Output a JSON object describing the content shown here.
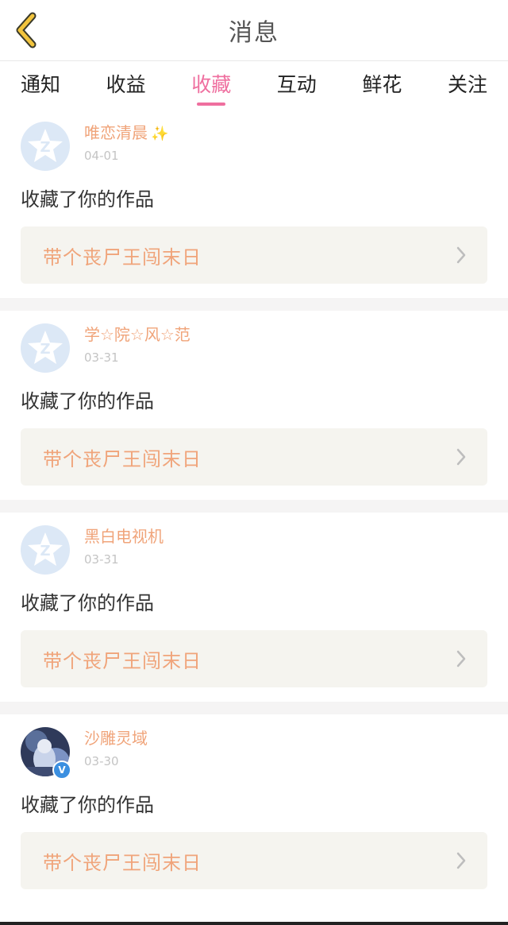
{
  "header": {
    "title": "消息",
    "back_icon": "chevron-left-icon",
    "accent": "#f2c43d"
  },
  "tabs": [
    {
      "label": "通知",
      "active": false
    },
    {
      "label": "收益",
      "active": false
    },
    {
      "label": "收藏",
      "active": true
    },
    {
      "label": "互动",
      "active": false
    },
    {
      "label": "鲜花",
      "active": false
    },
    {
      "label": "关注",
      "active": false
    }
  ],
  "colors": {
    "active_tab": "#ef6f9f",
    "username": "#f0a47a",
    "work_card_bg": "#f5f4ef"
  },
  "messages": [
    {
      "username": "唯恋清晨",
      "has_sparkle": true,
      "date": "04-01",
      "action": "收藏了你的作品",
      "work_title": "带个丧尸王闯末日",
      "avatar": "default-star-avatar"
    },
    {
      "username": "学☆院☆风☆范",
      "has_sparkle": false,
      "date": "03-31",
      "action": "收藏了你的作品",
      "work_title": "带个丧尸王闯末日",
      "avatar": "default-star-avatar"
    },
    {
      "username": "黑白电视机",
      "has_sparkle": false,
      "date": "03-31",
      "action": "收藏了你的作品",
      "work_title": "带个丧尸王闯末日",
      "avatar": "default-star-avatar"
    },
    {
      "username": "沙雕灵域",
      "has_sparkle": false,
      "date": "03-30",
      "action": "收藏了你的作品",
      "work_title": "带个丧尸王闯末日",
      "avatar": "photo-avatar",
      "verified": true
    }
  ]
}
